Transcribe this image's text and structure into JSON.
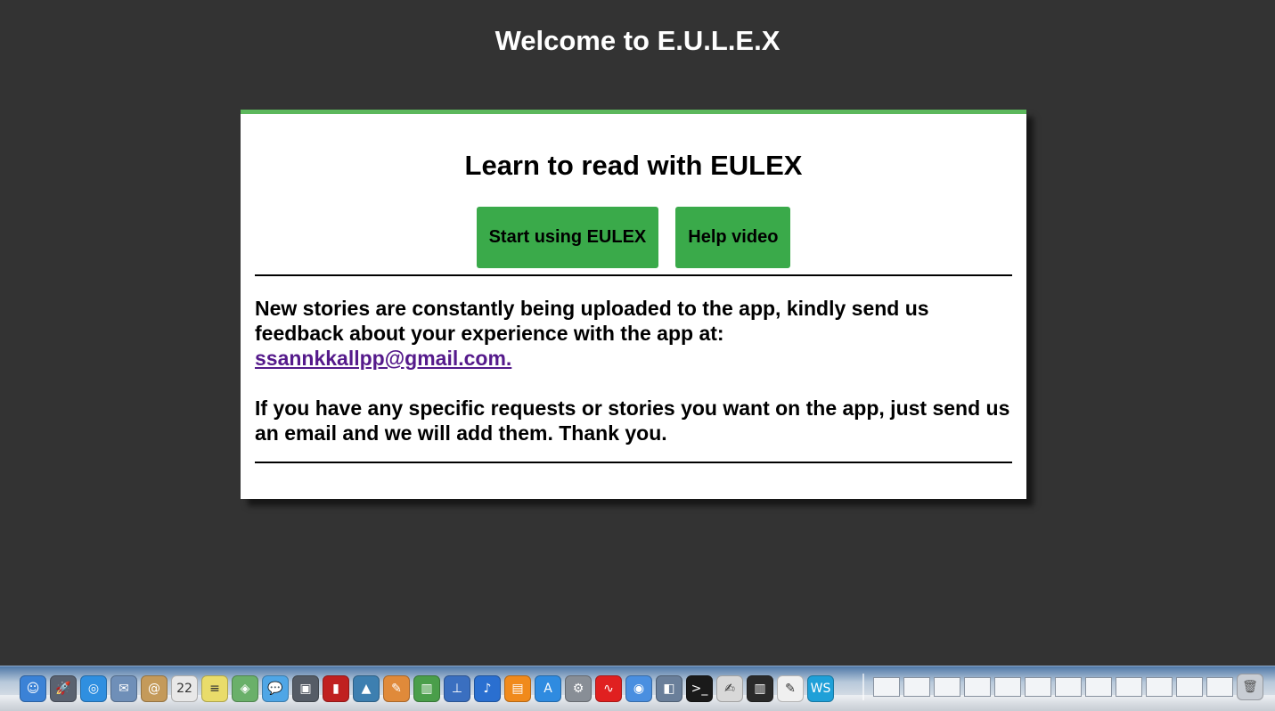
{
  "page": {
    "title": "Welcome to E.U.L.E.X"
  },
  "card": {
    "title": "Learn to read with EULEX",
    "buttons": {
      "start_label": "Start using EULEX",
      "help_label": "Help video"
    },
    "paragraph1": "New stories are constantly being uploaded to the app, kindly send us feedback about your experience with the app at:",
    "email_link": "ssannkkallpp@gmail.com. ",
    "paragraph2": "If you have any specific requests or stories you want on the app, just send us an email and we will add them. Thank you."
  },
  "colors": {
    "background": "#333333",
    "accent": "#5cb85c",
    "button": "#3aaa4a",
    "link": "#551a8b"
  },
  "dock": {
    "apps": [
      {
        "name": "finder-icon",
        "glyph": "☺",
        "color": "#3b82d6"
      },
      {
        "name": "launchpad-icon",
        "glyph": "🚀",
        "color": "#5a6270"
      },
      {
        "name": "safari-icon",
        "glyph": "◎",
        "color": "#2f8fe0"
      },
      {
        "name": "mail-stamp-icon",
        "glyph": "✉",
        "color": "#6f8fb8"
      },
      {
        "name": "contacts-icon",
        "glyph": "@",
        "color": "#c49a5a"
      },
      {
        "name": "calendar-icon",
        "glyph": "22",
        "color": "#e8e8e8"
      },
      {
        "name": "notes-icon",
        "glyph": "≡",
        "color": "#e9dc6a"
      },
      {
        "name": "maps-icon",
        "glyph": "◈",
        "color": "#6ab06a"
      },
      {
        "name": "messages-icon",
        "glyph": "💬",
        "color": "#4fa6e6"
      },
      {
        "name": "facetime-icon",
        "glyph": "▣",
        "color": "#555c66"
      },
      {
        "name": "photo-booth-icon",
        "glyph": "▮",
        "color": "#c02020"
      },
      {
        "name": "iphoto-icon",
        "glyph": "▲",
        "color": "#3d7fb0"
      },
      {
        "name": "pages-icon",
        "glyph": "✎",
        "color": "#e08a3a"
      },
      {
        "name": "numbers-icon",
        "glyph": "▥",
        "color": "#4a9e4a"
      },
      {
        "name": "keynote-icon",
        "glyph": "⊥",
        "color": "#3a6fc0"
      },
      {
        "name": "itunes-icon",
        "glyph": "♪",
        "color": "#2a6fd0"
      },
      {
        "name": "ibooks-icon",
        "glyph": "▤",
        "color": "#f08a1c"
      },
      {
        "name": "app-store-icon",
        "glyph": "A",
        "color": "#2f8be0"
      },
      {
        "name": "system-preferences-icon",
        "glyph": "⚙",
        "color": "#888e96"
      },
      {
        "name": "airtel-icon",
        "glyph": "∿",
        "color": "#e02020"
      },
      {
        "name": "chrome-icon",
        "glyph": "◉",
        "color": "#4a8fe0"
      },
      {
        "name": "preview-icon",
        "glyph": "◧",
        "color": "#6a7f9a"
      },
      {
        "name": "terminal-icon",
        "glyph": ">_",
        "color": "#1a1a1a"
      },
      {
        "name": "script-editor-icon",
        "glyph": "✍",
        "color": "#d8d8d8"
      },
      {
        "name": "piano-icon",
        "glyph": "▥",
        "color": "#2a2a2a"
      },
      {
        "name": "textedit-icon",
        "glyph": "✎",
        "color": "#f0f0f0"
      },
      {
        "name": "webstorm-icon",
        "glyph": "WS",
        "color": "#1fa0d8"
      }
    ],
    "trash_glyph": "🗑"
  }
}
